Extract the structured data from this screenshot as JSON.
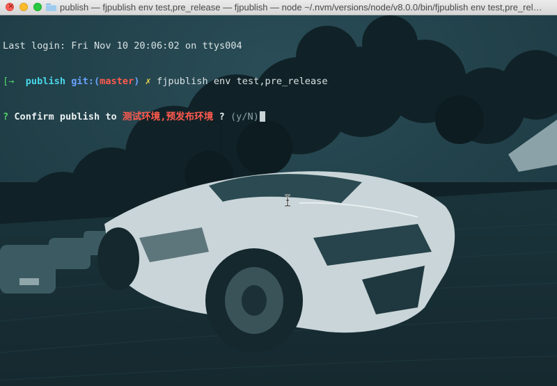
{
  "window": {
    "title": "publish — fjpublish env test,pre_release — fjpublish — node ~/.nvm/versions/node/v8.0.0/bin/fjpublish env test,pre_rel…",
    "title_icon": "folder-icon",
    "background_image": "dark teal tinted photo of a white sports car on a cobblestone street with trees"
  },
  "terminal": {
    "last_login": "Last login: Fri Nov 10 20:06:02 on ttys004",
    "prompt": {
      "bracket": "[",
      "arrow": "→",
      "cwd": "publish",
      "git_prefix": "git:(",
      "branch": "master",
      "git_suffix": ")",
      "dirty_mark": "✗",
      "command": "fjpublish env test,pre_release"
    },
    "question": {
      "mark": "?",
      "text": "Confirm publish to",
      "targets": "测试环境,预发布环境",
      "suffix": "?",
      "hint": "(y/N)"
    }
  },
  "colors": {
    "background": "#1d3a42",
    "prompt_arrow": "#54d36a",
    "cwd": "#49d6e8",
    "git": "#6aa3ff",
    "branch": "#ff5a4e",
    "dirty": "#e9d44a",
    "question_mark": "#55d36b",
    "highlight": "#ff5a4e"
  }
}
